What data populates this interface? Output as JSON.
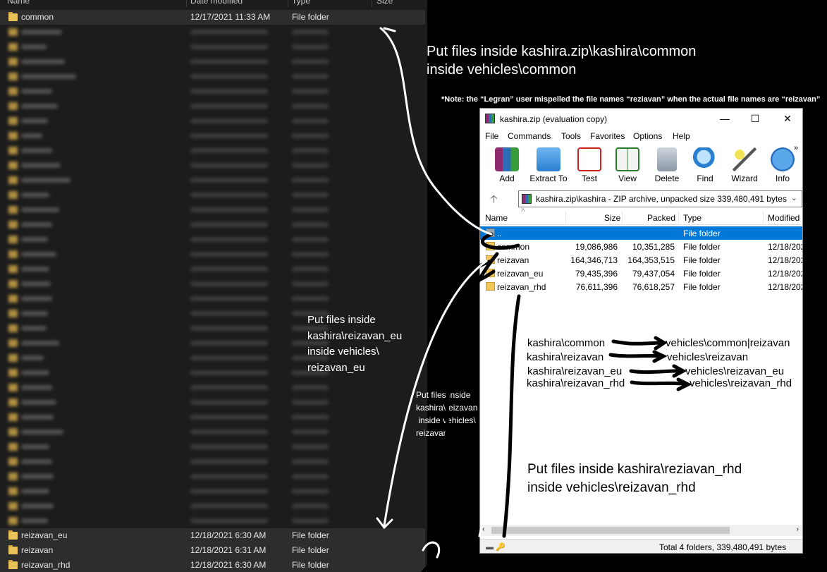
{
  "explorer": {
    "headers": {
      "name": "Name",
      "date": "Date modified",
      "type": "Type",
      "size": "Size"
    },
    "rows_top": [
      {
        "name": "common",
        "date": "12/17/2021 11:33 AM",
        "type": "File folder"
      }
    ],
    "rows_bottom": [
      {
        "name": "reizavan_eu",
        "date": "12/18/2021 6:30 AM",
        "type": "File folder"
      },
      {
        "name": "reizavan",
        "date": "12/18/2021 6:31 AM",
        "type": "File folder"
      },
      {
        "name": "reizavan_rhd",
        "date": "12/18/2021 6:30 AM",
        "type": "File folder"
      }
    ]
  },
  "annotations": {
    "top": "Put files inside kashira.zip\\kashira\\common\ninside vehicles\\common",
    "note": "*Note: the “Legran” user mispelled the file names “reziavan” when the actual file names are “reizavan”",
    "eu": "Put files inside\nkashira\\reizavan_eu\ninside vehicles\\\nreizavan_eu",
    "reizavan": "Put files inside\nkashira\\reizavan\n inside vehicles\\\nreizavan",
    "rhd": "Put files inside kashira\\reziavan_rhd\ninside vehicles\\reizavan_rhd",
    "map_left": [
      "kashira\\common",
      "kashira\\reizavan",
      "kashira\\reizavan_eu",
      "kashira\\reizavan_rhd"
    ],
    "map_right": [
      "vehicles\\common|reizavan",
      "vehicles\\reizavan",
      "vehicles\\reizavan_eu",
      "vehicles\\reizavan_rhd"
    ]
  },
  "winrar": {
    "title": "kashira.zip (evaluation copy)",
    "menu": [
      "File",
      "Commands",
      "Tools",
      "Favorites",
      "Options",
      "Help"
    ],
    "toolbar": [
      {
        "label": "Add",
        "icon": "add-icon"
      },
      {
        "label": "Extract To",
        "icon": "extract-icon"
      },
      {
        "label": "Test",
        "icon": "test-icon"
      },
      {
        "label": "View",
        "icon": "view-icon"
      },
      {
        "label": "Delete",
        "icon": "delete-icon"
      },
      {
        "label": "Find",
        "icon": "find-icon"
      },
      {
        "label": "Wizard",
        "icon": "wizard-icon"
      },
      {
        "label": "Info",
        "icon": "info-icon"
      }
    ],
    "path": "kashira.zip\\kashira - ZIP archive, unpacked size 339,480,491 bytes",
    "columns": {
      "name": "Name",
      "size": "Size",
      "packed": "Packed",
      "type": "Type",
      "modified": "Modified"
    },
    "rows": [
      {
        "name": "..",
        "size": "",
        "packed": "",
        "type": "File folder",
        "modified": ""
      },
      {
        "name": "common",
        "size": "19,086,986",
        "packed": "10,351,285",
        "type": "File folder",
        "modified": "12/18/202"
      },
      {
        "name": "reizavan",
        "size": "164,346,713",
        "packed": "164,353,515",
        "type": "File folder",
        "modified": "12/18/202"
      },
      {
        "name": "reizavan_eu",
        "size": "79,435,396",
        "packed": "79,437,054",
        "type": "File folder",
        "modified": "12/18/202"
      },
      {
        "name": "reizavan_rhd",
        "size": "76,611,396",
        "packed": "76,618,257",
        "type": "File folder",
        "modified": "12/18/202"
      }
    ],
    "status": "Total 4 folders, 339,480,491 bytes"
  }
}
